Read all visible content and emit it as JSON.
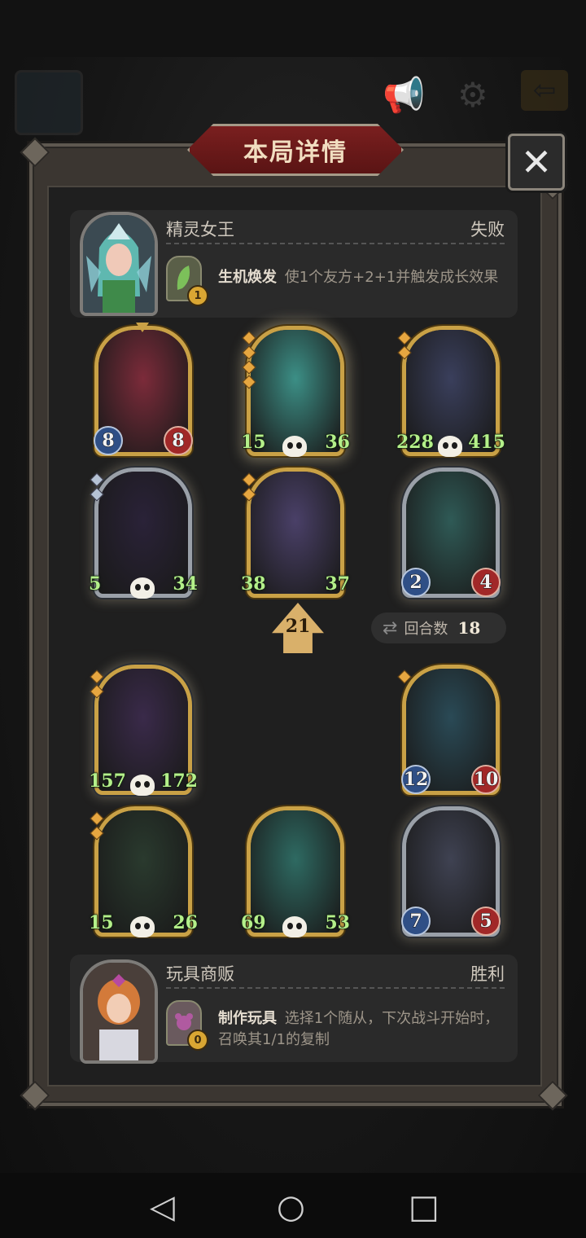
{
  "title": "本局详情",
  "close_label": "✕",
  "opponent": {
    "name": "精灵女王",
    "result": "失败",
    "ability_name": "生机焕发",
    "ability_desc": "使1个友方+2+1并触发成长效果",
    "ability_cost": "1"
  },
  "player": {
    "name": "玩具商贩",
    "result": "胜利",
    "ability_name": "制作玩具",
    "ability_desc": "选择1个随从，下次战斗开始时，召唤其1/1的复制",
    "ability_cost": "0"
  },
  "opponent_board": [
    {
      "name": "clown-minion",
      "attack": "8",
      "health": "8",
      "art_color": "#7c2b3a",
      "frame": "gold",
      "skull": false,
      "big_stats": false
    },
    {
      "name": "ghost-warrior-minion",
      "attack": "15",
      "health": "36",
      "art_color": "#3c8f86",
      "frame": "gold",
      "skull": true,
      "big_stats": true
    },
    {
      "name": "pirate-captain-minion",
      "attack": "228",
      "health": "415",
      "art_color": "#3a3f5c",
      "frame": "gold",
      "skull": true,
      "big_stats": true
    },
    {
      "name": "hooded-reaper-minion",
      "attack": "5",
      "health": "34",
      "art_color": "#2a2238",
      "frame": "silver",
      "skull": true,
      "big_stats": true
    },
    {
      "name": "sorceress-minion",
      "attack": "38",
      "health": "37",
      "art_color": "#4a4068",
      "frame": "gold",
      "skull": false,
      "big_stats": true
    },
    {
      "name": "red-hair-priestess-minion",
      "attack": "2",
      "health": "4",
      "art_color": "#2f5a56",
      "frame": "silver",
      "skull": false,
      "big_stats": false
    }
  ],
  "player_board": [
    {
      "name": "lich-king-minion",
      "attack": "157",
      "health": "172",
      "art_color": "#3a2a4a",
      "frame": "gold",
      "skull": true,
      "big_stats": true
    },
    {
      "name": "cyan-ghost-minion",
      "attack": "12",
      "health": "10",
      "art_color": "#2a4a56",
      "frame": "gold",
      "skull": false,
      "big_stats": false
    },
    {
      "name": "skull-mage-minion",
      "attack": "15",
      "health": "26",
      "art_color": "#2a3a2e",
      "frame": "gold",
      "skull": true,
      "big_stats": true
    },
    {
      "name": "spirit-brute-minion",
      "attack": "69",
      "health": "53",
      "art_color": "#2e6a62",
      "frame": "gold",
      "skull": true,
      "big_stats": true
    },
    {
      "name": "pumpkin-lock-minion",
      "attack": "7",
      "health": "5",
      "art_color": "#3f4252",
      "frame": "silver",
      "skull": false,
      "big_stats": false
    }
  ],
  "tavern_tier": "21",
  "round": {
    "label": "回合数",
    "value": "18"
  },
  "colors": {
    "accent_gold": "#c9a146",
    "banner_red": "#7a1f1f",
    "stat_green": "#b4f08a"
  }
}
